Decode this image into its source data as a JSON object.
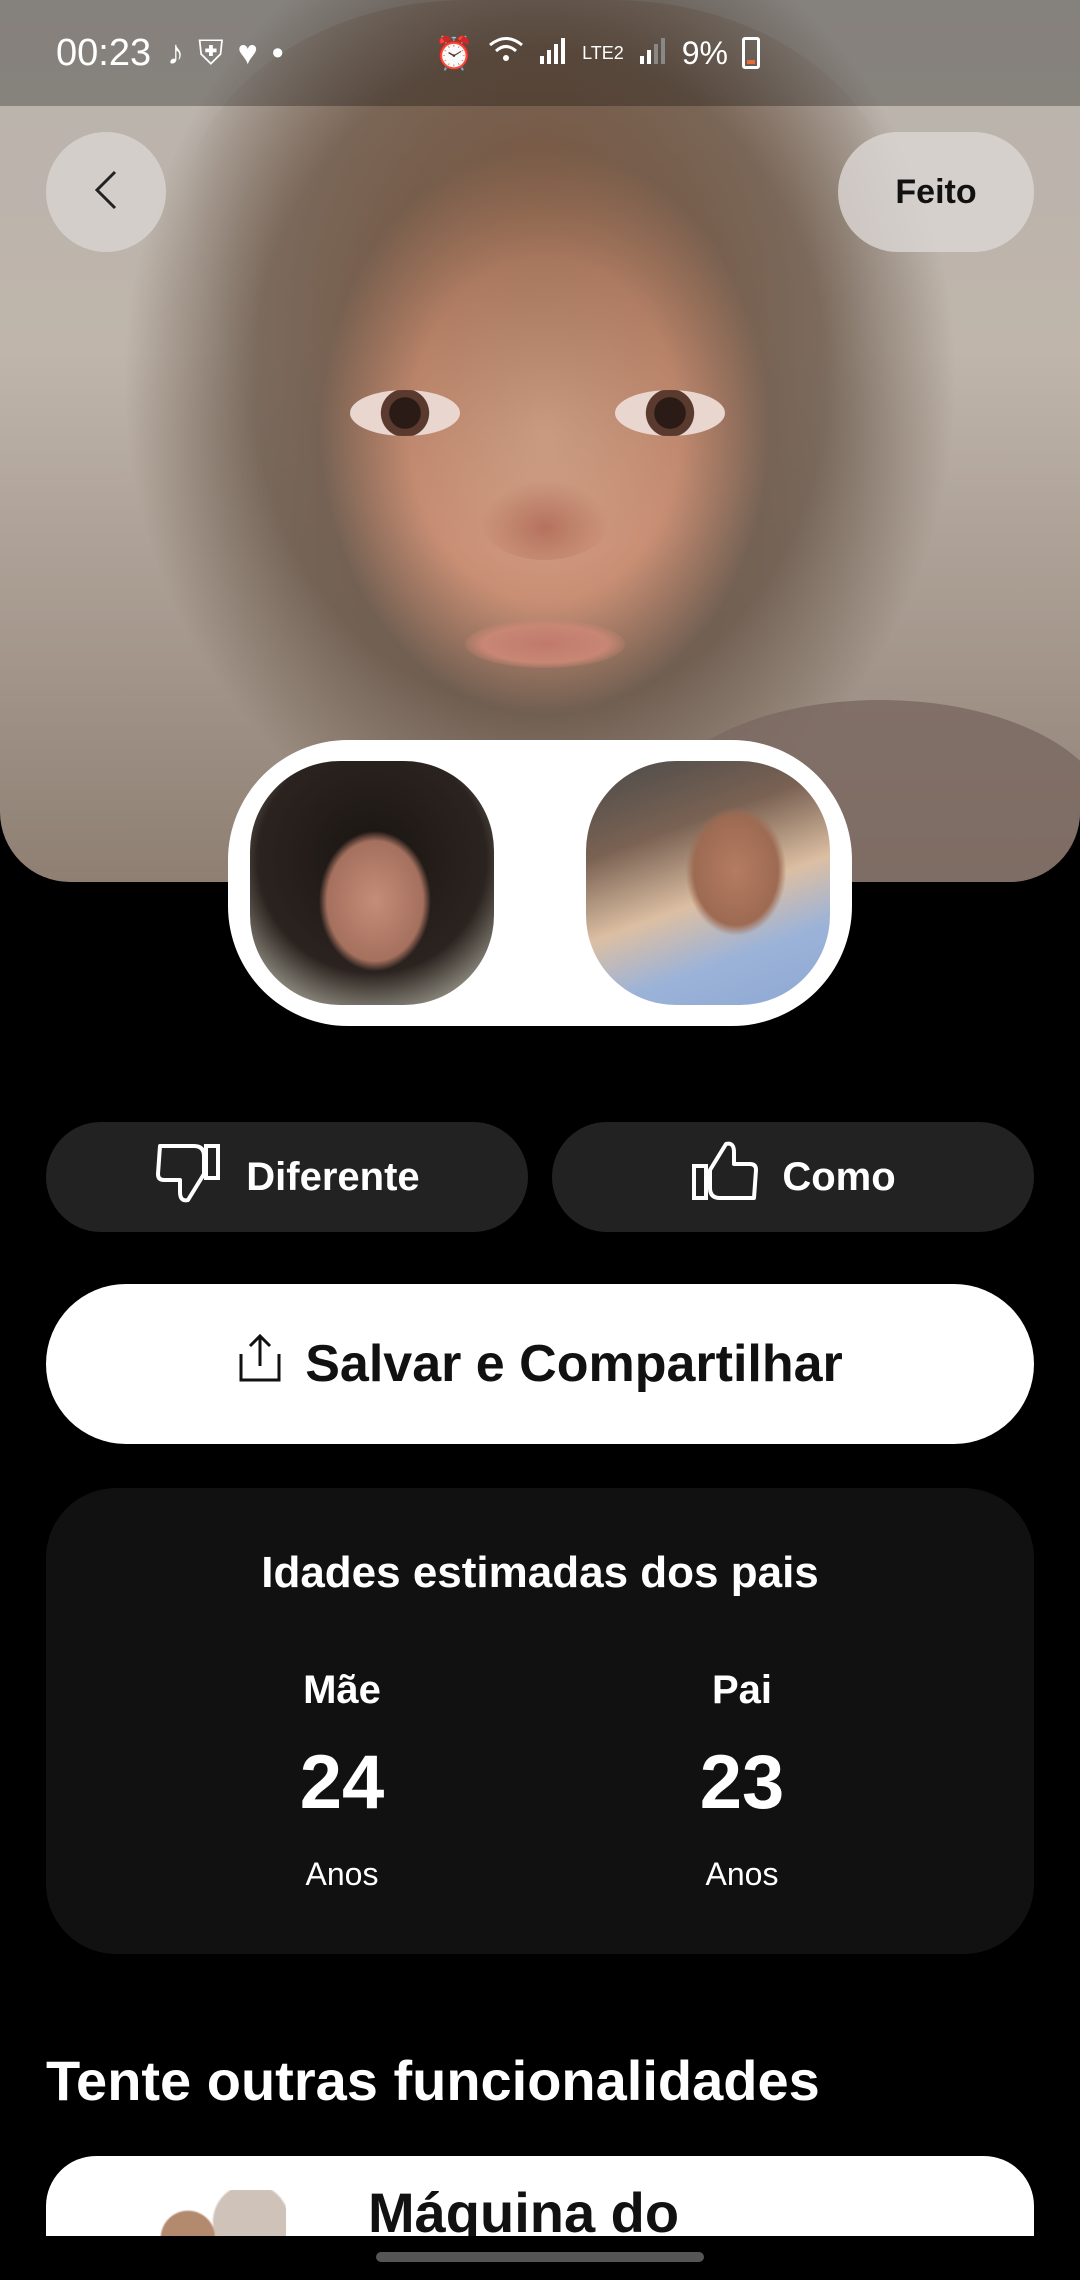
{
  "status_bar": {
    "time": "00:23",
    "battery": "9%",
    "network": "LTE2"
  },
  "header": {
    "back_icon": "chevron-left-icon",
    "done_label": "Feito"
  },
  "reactions": {
    "different_label": "Diferente",
    "like_label": "Como"
  },
  "actions": {
    "save_share_label": "Salvar e Compartilhar"
  },
  "ages": {
    "title": "Idades estimadas dos pais",
    "mother": {
      "label": "Mãe",
      "value": "24",
      "unit": "Anos"
    },
    "father": {
      "label": "Pai",
      "value": "23",
      "unit": "Anos"
    }
  },
  "features": {
    "section_title": "Tente outras funcionalidades",
    "first_card_title": "Máquina do"
  }
}
